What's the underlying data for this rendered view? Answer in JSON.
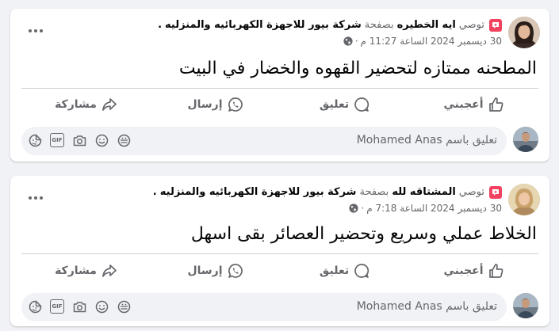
{
  "posts": [
    {
      "role_label": "توصي",
      "author": "ايه الخطيره",
      "via_text": "بصفحة",
      "page_name": "شركة بيور للاجهزة الكهربائيه والمنزليه",
      "timestamp": "30 ديسمبر 2024 الساعة 11:27 م",
      "separator": "·",
      "text": "المطحنه ممتازه لتحضير القهوه والخضار في البيت",
      "actions": {
        "like": "أعجبني",
        "comment": "تعليق",
        "send": "إرسال",
        "share": "مشاركة"
      },
      "comment_placeholder": "تعليق باسم Mohamed Anas"
    },
    {
      "role_label": "توصي",
      "author": "المشتاقه لله",
      "via_text": "بصفحة",
      "page_name": "شركة بيور للاجهزة الكهربائيه والمنزليه",
      "timestamp": "30 ديسمبر 2024 الساعة 7:18 م",
      "separator": "·",
      "text": "الخلاط عملي وسريع وتحضير العصائر بقى اسهل",
      "actions": {
        "like": "أعجبني",
        "comment": "تعليق",
        "send": "إرسال",
        "share": "مشاركة"
      },
      "comment_placeholder": "تعليق باسم Mohamed Anas"
    }
  ],
  "colors": {
    "badge": "#f3425f",
    "muted": "#65676b",
    "background": "#f0f2f5"
  },
  "icons": [
    "recommend-badge-icon",
    "globe-icon",
    "more-icon",
    "like-icon",
    "comment-icon",
    "whatsapp-icon",
    "share-icon",
    "sticker-icon",
    "gif-icon",
    "camera-icon",
    "emoji-icon",
    "avatar-sticker-icon"
  ]
}
